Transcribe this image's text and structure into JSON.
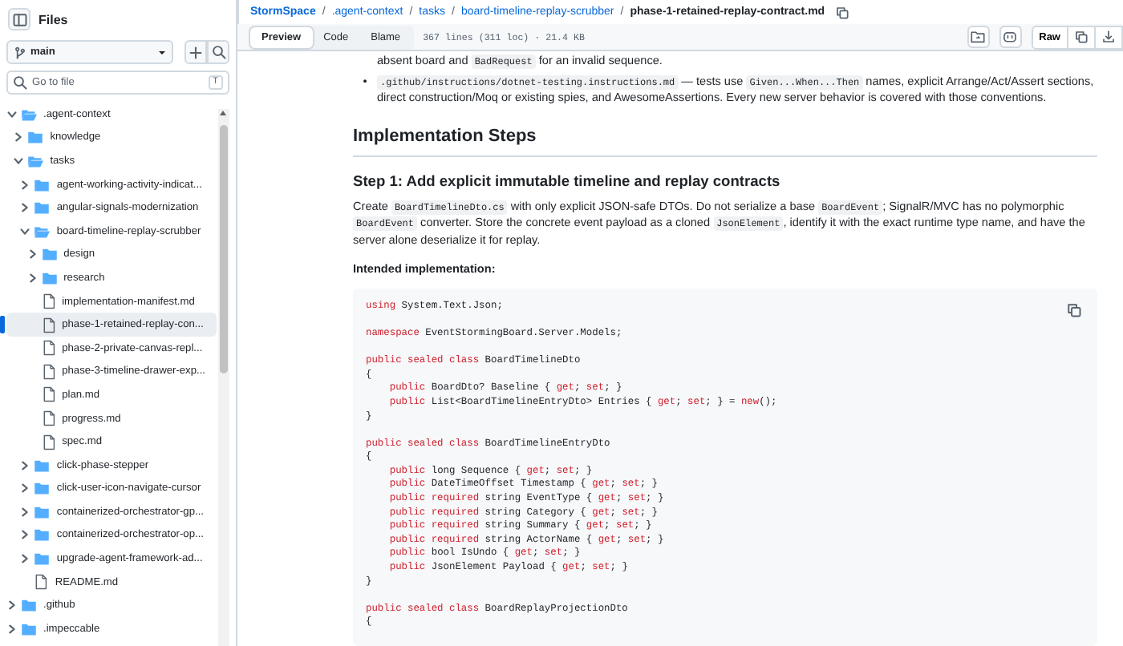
{
  "sidebar": {
    "title": "Files",
    "branch": "main",
    "go_to_file": {
      "placeholder": "Go to file",
      "shortcut": "T"
    },
    "tree": [
      {
        "kind": "folder",
        "name": ".agent-context",
        "expanded": true,
        "selected": false,
        "children": [
          {
            "kind": "folder",
            "name": "knowledge",
            "expanded": false,
            "selected": false
          },
          {
            "kind": "folder",
            "name": "tasks",
            "expanded": true,
            "selected": false,
            "children": [
              {
                "kind": "folder",
                "name": "agent-working-activity-indicat...",
                "expanded": false,
                "selected": false
              },
              {
                "kind": "folder",
                "name": "angular-signals-modernization",
                "expanded": false,
                "selected": false
              },
              {
                "kind": "folder",
                "name": "board-timeline-replay-scrubber",
                "expanded": true,
                "selected": false,
                "children": [
                  {
                    "kind": "folder",
                    "name": "design",
                    "expanded": false,
                    "selected": false
                  },
                  {
                    "kind": "folder",
                    "name": "research",
                    "expanded": false,
                    "selected": false
                  },
                  {
                    "kind": "file",
                    "name": "implementation-manifest.md",
                    "selected": false
                  },
                  {
                    "kind": "file",
                    "name": "phase-1-retained-replay-con...",
                    "selected": true
                  },
                  {
                    "kind": "file",
                    "name": "phase-2-private-canvas-repl...",
                    "selected": false
                  },
                  {
                    "kind": "file",
                    "name": "phase-3-timeline-drawer-exp...",
                    "selected": false
                  },
                  {
                    "kind": "file",
                    "name": "plan.md",
                    "selected": false
                  },
                  {
                    "kind": "file",
                    "name": "progress.md",
                    "selected": false
                  },
                  {
                    "kind": "file",
                    "name": "spec.md",
                    "selected": false
                  }
                ]
              },
              {
                "kind": "folder",
                "name": "click-phase-stepper",
                "expanded": false,
                "selected": false
              },
              {
                "kind": "folder",
                "name": "click-user-icon-navigate-cursor",
                "expanded": false,
                "selected": false
              },
              {
                "kind": "folder",
                "name": "containerized-orchestrator-gp...",
                "expanded": false,
                "selected": false
              },
              {
                "kind": "folder",
                "name": "containerized-orchestrator-op...",
                "expanded": false,
                "selected": false
              },
              {
                "kind": "folder",
                "name": "upgrade-agent-framework-ad...",
                "expanded": false,
                "selected": false
              },
              {
                "kind": "file",
                "name": "README.md",
                "selected": false
              }
            ]
          }
        ]
      },
      {
        "kind": "folder",
        "name": ".github",
        "expanded": false,
        "selected": false
      },
      {
        "kind": "folder",
        "name": ".impeccable",
        "expanded": false,
        "selected": false
      }
    ]
  },
  "breadcrumb": {
    "separator": "/",
    "items": [
      {
        "label": "StormSpace",
        "kind": "repo"
      },
      {
        "label": ".agent-context",
        "kind": "dir"
      },
      {
        "label": "tasks",
        "kind": "dir"
      },
      {
        "label": "board-timeline-replay-scrubber",
        "kind": "dir"
      },
      {
        "label": "phase-1-retained-replay-contract.md",
        "kind": "file"
      }
    ]
  },
  "toolbar": {
    "tabs": [
      {
        "label": "Preview",
        "selected": true
      },
      {
        "label": "Code",
        "selected": false
      },
      {
        "label": "Blame",
        "selected": false
      }
    ],
    "file_info": "367 lines (311 loc) · 21.4 KB",
    "raw_button": "Raw"
  },
  "document": {
    "bullets": [
      {
        "segments": [
          {
            "code": false,
            "text": "absent board and "
          },
          {
            "code": true,
            "text": "BadRequest"
          },
          {
            "code": false,
            "text": " for an invalid sequence."
          }
        ]
      },
      {
        "marker": "•",
        "segments": [
          {
            "code": true,
            "text": ".github/instructions/dotnet-testing.instructions.md"
          },
          {
            "code": false,
            "text": " — tests use "
          },
          {
            "code": true,
            "text": "Given...When...Then"
          },
          {
            "code": false,
            "text": " names, explicit Arrange/Act/Assert sections, direct construction/Moq or existing spies, and AwesomeAssertions. Every new server behavior is covered with those conventions."
          }
        ]
      }
    ],
    "heading": "Implementation Steps",
    "step_heading": "Step 1: Add explicit immutable timeline and replay contracts",
    "paragraph": [
      {
        "code": false,
        "text": "Create "
      },
      {
        "code": true,
        "text": "BoardTimelineDto.cs"
      },
      {
        "code": false,
        "text": " with only explicit JSON-safe DTOs. Do not serialize a base "
      },
      {
        "code": true,
        "text": "BoardEvent"
      },
      {
        "code": false,
        "text": "; SignalR/MVC has no polymorphic "
      },
      {
        "code": true,
        "text": "BoardEvent"
      },
      {
        "code": false,
        "text": " converter. Store the concrete event payload as a cloned "
      },
      {
        "code": true,
        "text": "JsonElement"
      },
      {
        "code": false,
        "text": ", identify it with the exact runtime type name, and have the server alone deserialize it for replay."
      }
    ],
    "label": "Intended implementation:",
    "code_groups": [
      [
        [
          {
            "kind": "keyword",
            "text": "using"
          },
          {
            "kind": "plain",
            "text": " System.Text.Json;"
          }
        ]
      ],
      [
        [
          {
            "kind": "keyword",
            "text": "namespace"
          },
          {
            "kind": "plain",
            "text": " EventStormingBoard.Server.Models;"
          }
        ]
      ],
      [
        [
          {
            "kind": "keyword",
            "text": "public sealed class"
          },
          {
            "kind": "plain",
            "text": " BoardTimelineDto"
          }
        ],
        [
          {
            "kind": "plain",
            "text": "{"
          }
        ],
        [
          {
            "kind": "keyword",
            "text": "    public"
          },
          {
            "kind": "plain",
            "text": " BoardDto? Baseline { "
          },
          {
            "kind": "keyword",
            "text": "get"
          },
          {
            "kind": "plain",
            "text": "; "
          },
          {
            "kind": "keyword",
            "text": "set"
          },
          {
            "kind": "plain",
            "text": "; }"
          }
        ],
        [
          {
            "kind": "keyword",
            "text": "    public"
          },
          {
            "kind": "plain",
            "text": " List<BoardTimelineEntryDto> Entries { "
          },
          {
            "kind": "keyword",
            "text": "get"
          },
          {
            "kind": "plain",
            "text": "; "
          },
          {
            "kind": "keyword",
            "text": "set"
          },
          {
            "kind": "plain",
            "text": "; } = "
          },
          {
            "kind": "keyword",
            "text": "new"
          },
          {
            "kind": "plain",
            "text": "();"
          }
        ],
        [
          {
            "kind": "plain",
            "text": "}"
          }
        ]
      ],
      [
        [
          {
            "kind": "keyword",
            "text": "public sealed class"
          },
          {
            "kind": "plain",
            "text": " BoardTimelineEntryDto"
          }
        ],
        [
          {
            "kind": "plain",
            "text": "{"
          }
        ],
        [
          {
            "kind": "keyword",
            "text": "    public"
          },
          {
            "kind": "plain",
            "text": " long Sequence { "
          },
          {
            "kind": "keyword",
            "text": "get"
          },
          {
            "kind": "plain",
            "text": "; "
          },
          {
            "kind": "keyword",
            "text": "set"
          },
          {
            "kind": "plain",
            "text": "; }"
          }
        ],
        [
          {
            "kind": "keyword",
            "text": "    public"
          },
          {
            "kind": "plain",
            "text": " DateTimeOffset Timestamp { "
          },
          {
            "kind": "keyword",
            "text": "get"
          },
          {
            "kind": "plain",
            "text": "; "
          },
          {
            "kind": "keyword",
            "text": "set"
          },
          {
            "kind": "plain",
            "text": "; }"
          }
        ],
        [
          {
            "kind": "keyword",
            "text": "    public required"
          },
          {
            "kind": "plain",
            "text": " string EventType { "
          },
          {
            "kind": "keyword",
            "text": "get"
          },
          {
            "kind": "plain",
            "text": "; "
          },
          {
            "kind": "keyword",
            "text": "set"
          },
          {
            "kind": "plain",
            "text": "; }"
          }
        ],
        [
          {
            "kind": "keyword",
            "text": "    public required"
          },
          {
            "kind": "plain",
            "text": " string Category { "
          },
          {
            "kind": "keyword",
            "text": "get"
          },
          {
            "kind": "plain",
            "text": "; "
          },
          {
            "kind": "keyword",
            "text": "set"
          },
          {
            "kind": "plain",
            "text": "; }"
          }
        ],
        [
          {
            "kind": "keyword",
            "text": "    public required"
          },
          {
            "kind": "plain",
            "text": " string Summary { "
          },
          {
            "kind": "keyword",
            "text": "get"
          },
          {
            "kind": "plain",
            "text": "; "
          },
          {
            "kind": "keyword",
            "text": "set"
          },
          {
            "kind": "plain",
            "text": "; }"
          }
        ],
        [
          {
            "kind": "keyword",
            "text": "    public required"
          },
          {
            "kind": "plain",
            "text": " string ActorName { "
          },
          {
            "kind": "keyword",
            "text": "get"
          },
          {
            "kind": "plain",
            "text": "; "
          },
          {
            "kind": "keyword",
            "text": "set"
          },
          {
            "kind": "plain",
            "text": "; }"
          }
        ],
        [
          {
            "kind": "keyword",
            "text": "    public"
          },
          {
            "kind": "plain",
            "text": " bool IsUndo { "
          },
          {
            "kind": "keyword",
            "text": "get"
          },
          {
            "kind": "plain",
            "text": "; "
          },
          {
            "kind": "keyword",
            "text": "set"
          },
          {
            "kind": "plain",
            "text": "; }"
          }
        ],
        [
          {
            "kind": "keyword",
            "text": "    public"
          },
          {
            "kind": "plain",
            "text": " JsonElement Payload { "
          },
          {
            "kind": "keyword",
            "text": "get"
          },
          {
            "kind": "plain",
            "text": "; "
          },
          {
            "kind": "keyword",
            "text": "set"
          },
          {
            "kind": "plain",
            "text": "; }"
          }
        ],
        [
          {
            "kind": "plain",
            "text": "}"
          }
        ]
      ],
      [
        [
          {
            "kind": "keyword",
            "text": "public sealed class"
          },
          {
            "kind": "plain",
            "text": " BoardReplayProjectionDto"
          }
        ],
        [
          {
            "kind": "plain",
            "text": "{"
          }
        ]
      ]
    ]
  }
}
